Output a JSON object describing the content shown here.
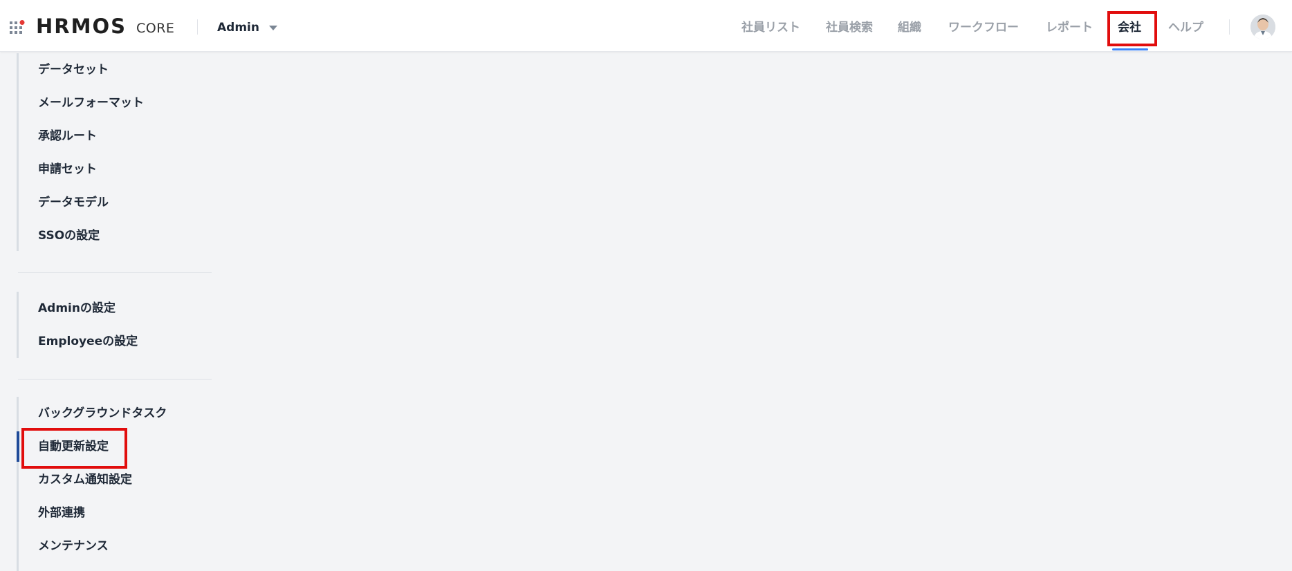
{
  "header": {
    "logo_text": "HRMOS",
    "logo_sub": "CORE",
    "role": "Admin",
    "nav": [
      "社員リスト",
      "社員検索",
      "組織",
      "ワークフロー",
      "レポート",
      "会社",
      "ヘルプ"
    ],
    "active_nav": "会社",
    "accent_color": "#3b82f6",
    "highlight_color": "#e10d0d"
  },
  "sidebar": {
    "group1": [
      "データセット",
      "メールフォーマット",
      "承認ルート",
      "申請セット",
      "データモデル",
      "SSOの設定"
    ],
    "group2": [
      "Adminの設定",
      "Employeeの設定"
    ],
    "group3": [
      "バックグラウンドタスク",
      "自動更新設定",
      "カスタム通知設定",
      "外部連携",
      "メンテナンス"
    ],
    "active_item": "自動更新設定"
  }
}
